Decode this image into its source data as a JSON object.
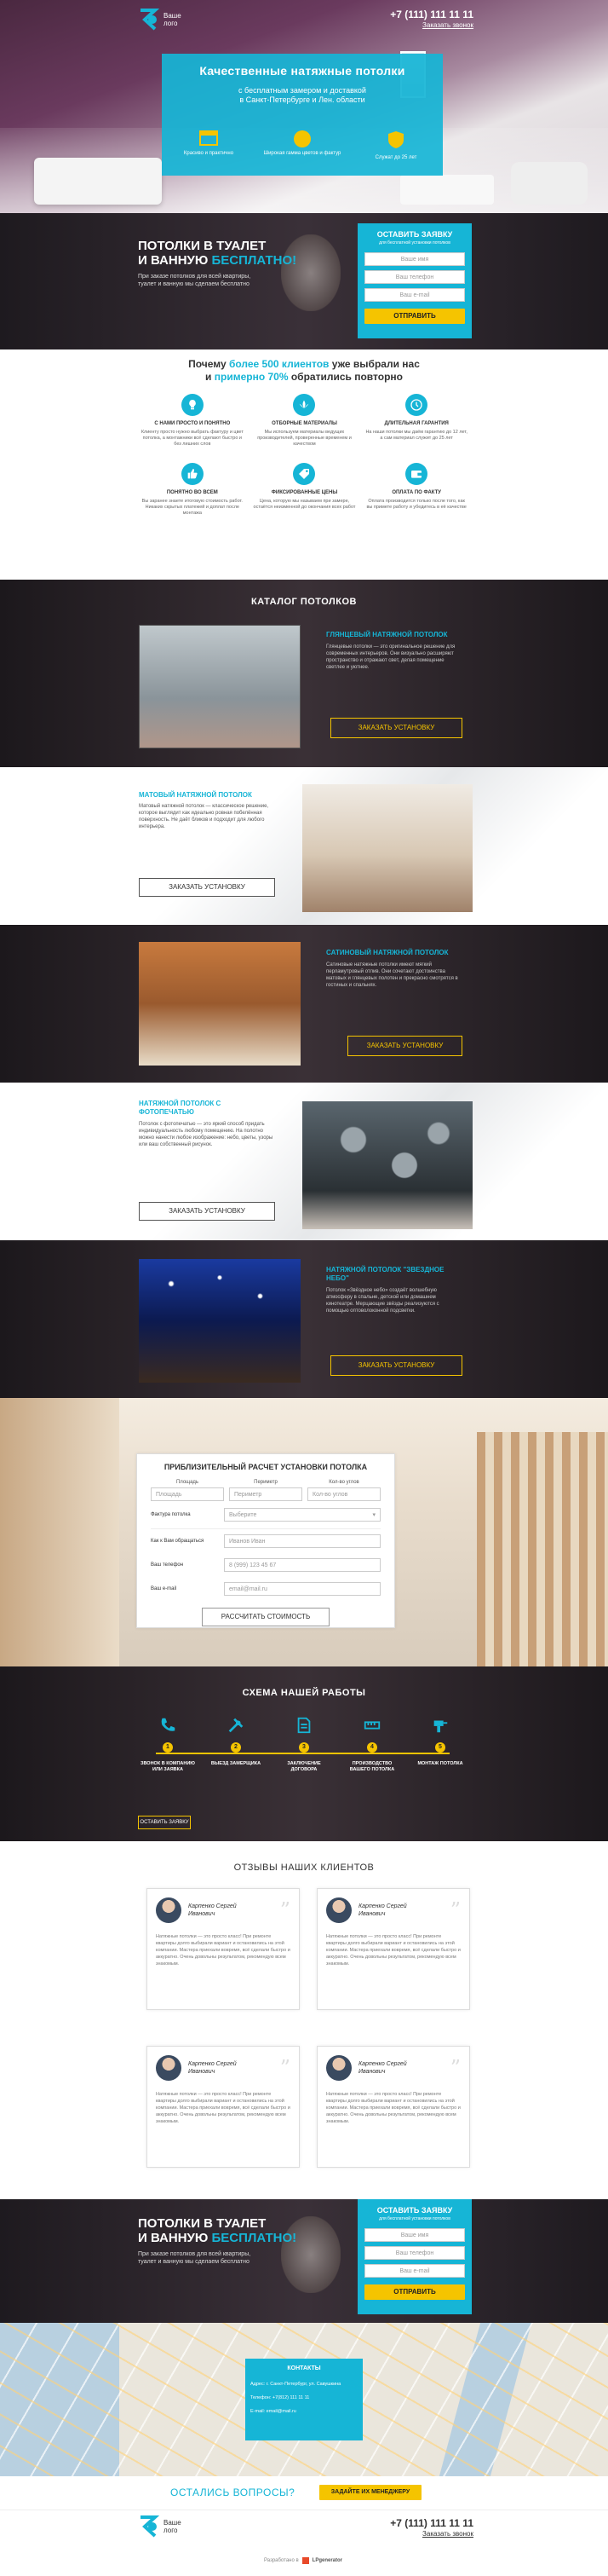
{
  "header": {
    "logo_line1": "Ваше",
    "logo_line2": "лого",
    "phone": "+7 (111) 111 11 11",
    "callback": "Заказать звонок"
  },
  "hero": {
    "title": "Качественные натяжные потолки",
    "subtitle_line1": "с бесплатным замером и доставкой",
    "subtitle_line2": "в Санкт-Петербурге и Лен. области",
    "features": [
      {
        "label": "Красиво и практично",
        "icon": "ceiling-icon"
      },
      {
        "label": "Широкая гамма цветов и фактур",
        "icon": "palette-icon"
      },
      {
        "label": "Служат до 25 лет",
        "icon": "shield-icon"
      }
    ]
  },
  "promo1": {
    "title_line1": "ПОТОЛКИ В ТУАЛЕТ",
    "title_line2_a": "И ВАННУЮ ",
    "title_line2_b": "БЕСПЛАТНО!",
    "text_line1": "При заказе потолков для всей квартиры,",
    "text_line2": "туалет и ванную мы сделаем бесплатно",
    "form": {
      "title": "ОСТАВИТЬ ЗАЯВКУ",
      "subtitle": "для бесплатной установки потолков",
      "name_ph": "Ваше имя",
      "phone_ph": "Ваш телефон",
      "email_ph": "Ваш e-mail",
      "submit": "Отправить"
    }
  },
  "why": {
    "line1_a": "Почему ",
    "line1_b": "более 500 клиентов",
    "line1_c": " уже выбрали нас",
    "line2_a": "и ",
    "line2_b": "примерно 70%",
    "line2_c": " обратились повторно",
    "items": [
      {
        "title": "С НАМИ ПРОСТО И ПОНЯТНО",
        "text": "Клиенту просто нужно выбрать фактуру и цвет потолка, а монтажники всё сделают быстро и без лишних слов",
        "icon": "lightbulb-icon"
      },
      {
        "title": "ОТБОРНЫЕ МАТЕРИАЛЫ",
        "text": "Мы используем материалы ведущих производителей, проверенные временем и качеством",
        "icon": "lotus-icon"
      },
      {
        "title": "ДЛИТЕЛЬНАЯ ГАРАНТИЯ",
        "text": "На наши потолки мы даём гарантию до 12 лет, а сам материал служит до 25 лет",
        "icon": "clock-icon"
      },
      {
        "title": "ПОНЯТНО ВО ВСЕМ",
        "text": "Вы заранее знаете итоговую стоимость работ. Никаких скрытых платежей и доплат после монтажа",
        "icon": "thumbs-up-icon"
      },
      {
        "title": "ФИКСИРОВАННЫЕ ЦЕНЫ",
        "text": "Цена, которую мы называем при замере, остаётся неизменной до окончания всех работ",
        "icon": "price-tag-icon"
      },
      {
        "title": "ОПЛАТА ПО ФАКТУ",
        "text": "Оплата производится только после того, как вы примете работу и убедитесь в её качестве",
        "icon": "wallet-icon"
      }
    ]
  },
  "catalog": {
    "title": "КАТАЛОГ ПОТОЛКОВ",
    "items": [
      {
        "title": "ГЛЯНЦЕВЫЙ НАТЯЖНОЙ ПОТОЛОК",
        "text": "Глянцевые потолки — это оригинальное решение для современных интерьеров. Они визуально расширяют пространство и отражают свет, делая помещение светлее и уютнее.",
        "button": "Заказать установку"
      },
      {
        "title": "МАТОВЫЙ НАТЯЖНОЙ ПОТОЛОК",
        "text": "Матовый натяжной потолок — классическое решение, которое выглядит как идеально ровная побелённая поверхность. Не даёт бликов и подходит для любого интерьера.",
        "button": "Заказать установку"
      },
      {
        "title": "САТИНОВЫЙ НАТЯЖНОЙ ПОТОЛОК",
        "text": "Сатиновые натяжные потолки имеют мягкий перламутровый отлив. Они сочетают достоинства матовых и глянцевых полотен и прекрасно смотрятся в гостиных и спальнях.",
        "button": "Заказать установку"
      },
      {
        "title": "НАТЯЖНОЙ ПОТОЛОК С ФОТОПЕЧАТЬЮ",
        "text": "Потолок с фотопечатью — это яркий способ придать индивидуальность любому помещению. На полотно можно нанести любое изображение: небо, цветы, узоры или ваш собственный рисунок.",
        "button": "Заказать установку"
      },
      {
        "title": "НАТЯЖНОЙ ПОТОЛОК \"ЗВЕЗДНОЕ НЕБО\"",
        "text": "Потолок «Звёздное небо» создаёт волшебную атмосферу в спальне, детской или домашнем кинотеатре. Мерцающие звёзды реализуются с помощью оптоволоконной подсветки.",
        "button": "Заказать установку"
      }
    ]
  },
  "calc": {
    "title": "ПРИБЛИЗИТЕЛЬНЫЙ РАСЧЕТ УСТАНОВКИ ПОТОЛКА",
    "col_area": "Площадь",
    "col_perim": "Периметр",
    "col_lamps": "Кол-во углов",
    "area_ph": "Площадь",
    "perim_ph": "Периметр",
    "lamps_ph": "Кол-во углов",
    "texture_label": "Фактура потолка",
    "texture_value": "Выберите",
    "city_label": "Как к Вам обращаться",
    "city_ph": "Иванов Иван",
    "phone_label": "Ваш телефон",
    "phone_ph": "8 (999) 123 45 67",
    "email_label": "Ваш e-mail",
    "email_ph": "email@mail.ru",
    "submit": "Рассчитать стоимость"
  },
  "scheme": {
    "title": "СХЕМА НАШЕЙ РАБОТЫ",
    "steps": [
      {
        "num": "1",
        "title": "ЗВОНОК В КОМПАНИЮ ИЛИ ЗАЯВКА",
        "icon": "phone-icon"
      },
      {
        "num": "2",
        "title": "ВЫЕЗД ЗАМЕРЩИКА",
        "icon": "tools-icon"
      },
      {
        "num": "3",
        "title": "ЗАКЛЮЧЕНИЕ ДОГОВОРА",
        "icon": "document-icon"
      },
      {
        "num": "4",
        "title": "ПРОИЗВОДСТВО ВАШЕГО ПОТОЛКА",
        "icon": "ruler-icon"
      },
      {
        "num": "5",
        "title": "МОНТАЖ ПОТОЛКА",
        "icon": "drill-icon"
      }
    ],
    "button": "Оставить заявку"
  },
  "reviews": {
    "title": "ОТЗЫВЫ НАШИХ КЛИЕНТОВ",
    "items": [
      {
        "name_line1": "Карпенко Сергей",
        "name_line2": "Иванович",
        "text": "Натяжные потолки — это просто класс! При ремонте квартиры долго выбирали вариант и остановились на этой компании. Мастера приехали вовремя, всё сделали быстро и аккуратно. Очень довольны результатом, рекомендую всем знакомым."
      },
      {
        "name_line1": "Карпенко Сергей",
        "name_line2": "Иванович",
        "text": "Натяжные потолки — это просто класс! При ремонте квартиры долго выбирали вариант и остановились на этой компании. Мастера приехали вовремя, всё сделали быстро и аккуратно. Очень довольны результатом, рекомендую всем знакомым."
      },
      {
        "name_line1": "Карпенко Сергей",
        "name_line2": "Иванович",
        "text": "Натяжные потолки — это просто класс! При ремонте квартиры долго выбирали вариант и остановились на этой компании. Мастера приехали вовремя, всё сделали быстро и аккуратно. Очень довольны результатом, рекомендую всем знакомым."
      },
      {
        "name_line1": "Карпенко Сергей",
        "name_line2": "Иванович",
        "text": "Натяжные потолки — это просто класс! При ремонте квартиры долго выбирали вариант и остановились на этой компании. Мастера приехали вовремя, всё сделали быстро и аккуратно. Очень довольны результатом, рекомендую всем знакомым."
      }
    ]
  },
  "promo2": {
    "title_line1": "ПОТОЛКИ В ТУАЛЕТ",
    "title_line2_a": "И ВАННУЮ ",
    "title_line2_b": "БЕСПЛАТНО!",
    "text_line1": "При заказе потолков для всей квартиры,",
    "text_line2": "туалет и ванную мы сделаем бесплатно",
    "form": {
      "title": "ОСТАВИТЬ ЗАЯВКУ",
      "subtitle": "для бесплатной установки потолков",
      "name_ph": "Ваше имя",
      "phone_ph": "Ваш телефон",
      "email_ph": "Ваш e-mail",
      "submit": "Отправить"
    }
  },
  "contacts": {
    "title": "КОНТАКТЫ",
    "address": "Адрес: г. Санкт-Петербург, ул. Савушкина",
    "phone": "Телефон: +7(812) 111 11 11",
    "email": "E-mail: email@mail.ru"
  },
  "questions": {
    "text": "ОСТАЛИСЬ ВОПРОСЫ?",
    "button": "ЗАДАЙТЕ ИХ МЕНЕДЖЕРУ"
  },
  "footer": {
    "logo_line1": "Ваше",
    "logo_line2": "лого",
    "phone": "+7 (111) 111 11 11",
    "callback": "Заказать звонок",
    "made_with": "Разработано в",
    "platform": "LPgenerator"
  },
  "colors": {
    "accent": "#16b5d6",
    "yellow": "#f5c400",
    "dark": "#2a2328"
  }
}
